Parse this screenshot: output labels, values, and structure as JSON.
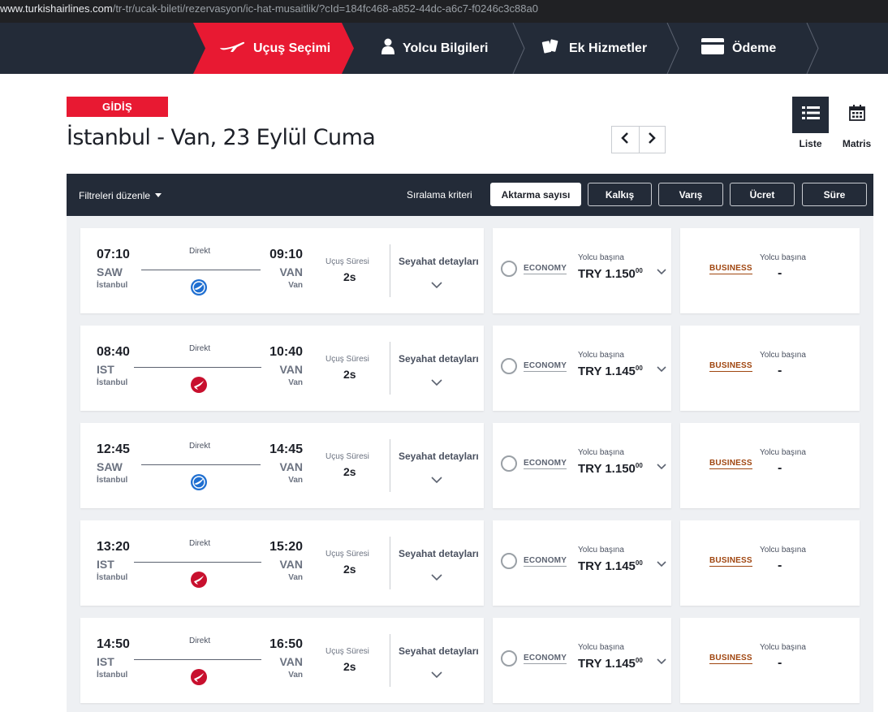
{
  "browser": {
    "url_host": "www.turkishairlines.com",
    "url_path": "/tr-tr/ucak-bileti/rezervasyon/ic-hat-musaitlik/?cId=184fc468-a852-44dc-a6c7-f0246c3c88a0"
  },
  "steps": [
    {
      "label": "Uçuş Seçimi",
      "icon": "plane-icon",
      "active": true
    },
    {
      "label": "Yolcu Bilgileri",
      "icon": "person-icon",
      "active": false
    },
    {
      "label": "Ek Hizmetler",
      "icon": "tickets-icon",
      "active": false
    },
    {
      "label": "Ödeme",
      "icon": "card-icon",
      "active": false
    }
  ],
  "direction_badge": "GİDİŞ",
  "route_title": "İstanbul - Van, 23 Eylül Cuma",
  "view_toggle": {
    "list_label": "Liste",
    "matrix_label": "Matris",
    "active": "list"
  },
  "filter_bar": {
    "edit_filters": "Filtreleri düzenle",
    "sort_label": "Sıralama kriteri",
    "sort_options": [
      "Aktarma sayısı",
      "Kalkış",
      "Varış",
      "Ücret",
      "Süre"
    ],
    "active_sort": "Aktarma sayısı"
  },
  "labels": {
    "direct": "Direkt",
    "duration": "Uçuş Süresi",
    "details": "Seyahat detayları",
    "economy": "ECONOMY",
    "business": "BUSINESS",
    "per_passenger": "Yolcu başına",
    "no_price": "-"
  },
  "colors": {
    "brand_red": "#e81932",
    "navy": "#232b38",
    "business_brown": "#a04610"
  },
  "flights": [
    {
      "dep_time": "07:10",
      "dep_code": "SAW",
      "dep_city": "İstanbul",
      "arr_time": "09:10",
      "arr_code": "VAN",
      "arr_city": "Van",
      "duration": "2s",
      "carrier": "anadolujet",
      "economy_price": "TRY 1.150",
      "economy_cents": "00"
    },
    {
      "dep_time": "08:40",
      "dep_code": "IST",
      "dep_city": "İstanbul",
      "arr_time": "10:40",
      "arr_code": "VAN",
      "arr_city": "Van",
      "duration": "2s",
      "carrier": "thy",
      "economy_price": "TRY 1.145",
      "economy_cents": "00"
    },
    {
      "dep_time": "12:45",
      "dep_code": "SAW",
      "dep_city": "İstanbul",
      "arr_time": "14:45",
      "arr_code": "VAN",
      "arr_city": "Van",
      "duration": "2s",
      "carrier": "anadolujet",
      "economy_price": "TRY 1.150",
      "economy_cents": "00"
    },
    {
      "dep_time": "13:20",
      "dep_code": "IST",
      "dep_city": "İstanbul",
      "arr_time": "15:20",
      "arr_code": "VAN",
      "arr_city": "Van",
      "duration": "2s",
      "carrier": "thy",
      "economy_price": "TRY 1.145",
      "economy_cents": "00"
    },
    {
      "dep_time": "14:50",
      "dep_code": "IST",
      "dep_city": "İstanbul",
      "arr_time": "16:50",
      "arr_code": "VAN",
      "arr_city": "Van",
      "duration": "2s",
      "carrier": "thy",
      "economy_price": "TRY 1.145",
      "economy_cents": "00"
    }
  ]
}
